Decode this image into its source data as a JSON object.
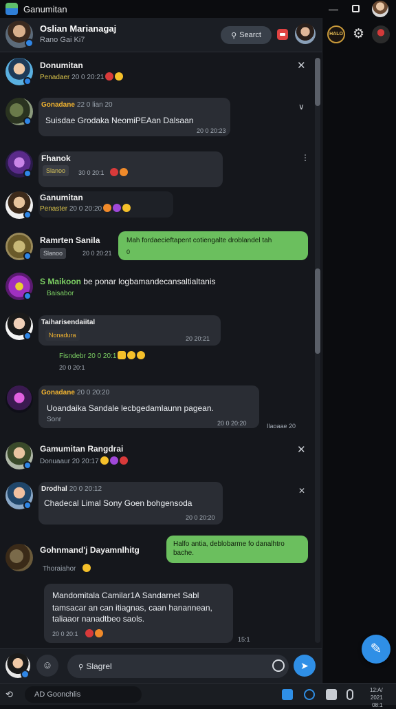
{
  "window": {
    "title": "Ganumitan"
  },
  "header": {
    "title": "Oslian Marianagaj",
    "subtitle": "Rano Gai Ki7",
    "search_label": "Searct"
  },
  "right_pane": {
    "logo_text": "HALO"
  },
  "messages": [
    {
      "name": "Donumitan",
      "sub": "Penadaer",
      "time": "20 0 20:21"
    },
    {
      "sender": "Gonadane",
      "time": "22 0 lian 20",
      "text": "Suisdae Grodaka NeomiPEAan Dalsaan",
      "meta": "20 0 20:23"
    },
    {
      "name": "Fhanok",
      "chip": "Slanoo",
      "time": "30 0 20:1"
    },
    {
      "name": "Ganumitan",
      "sub": "Penaster",
      "time": "20 0 20:20"
    },
    {
      "name": "Ramrten Sanila",
      "chip": "Slanoo",
      "time": "20 0 20:21",
      "out_text": "Mah fordaecieftapent cotiengalte droblandel tah",
      "out_meta": "0"
    },
    {
      "name": "S Maikoon",
      "name_rest": "be ponar logbamandecansaltialtanis",
      "sub": "Baisabor"
    },
    {
      "sender": "Taiharisendaiital",
      "chip": "Nonadura",
      "meta": "20 20:21",
      "sub": "Fisndebr 20 0 20:1",
      "sub2": "20 0 20:1"
    },
    {
      "sender": "Gonadane",
      "time": "20 0 20:20",
      "text": "Uoandaika Sandale lecbgedamlaunn pagean.",
      "meta": "20 0 20:20",
      "sub": "Sonr",
      "side_meta": "Ilaoaae 20"
    },
    {
      "name": "Gamumitan Rangdrai",
      "sub": "Donuaaur",
      "time": "20 20:17"
    },
    {
      "sender": "Drodhal",
      "time": "20 0 20:12",
      "text": "Chadecal Limal Sony Goen bohgensoda",
      "meta": "20 0 20:20"
    },
    {
      "name": "Gohnmand'j Dayamnlhitg",
      "sub": "Thoraiahor",
      "out_text": "Halfo antia, deblobarme fo danalhtro bache."
    },
    {
      "text_lines": [
        "Mandomitala Camilar1A Sandarnet Sabl",
        "tamsacar an can itiagnas, caan hanannean,",
        "taliaaor nanadtbeo saols."
      ],
      "meta": "20 0 20:1",
      "side_meta": "15:1"
    }
  ],
  "composer": {
    "placeholder": "Slagrel"
  },
  "taskbar": {
    "search_label": "AD Goonchlis",
    "tray_line1": "12:A/",
    "tray_line2": "2021",
    "tray_line3": "08:1"
  }
}
